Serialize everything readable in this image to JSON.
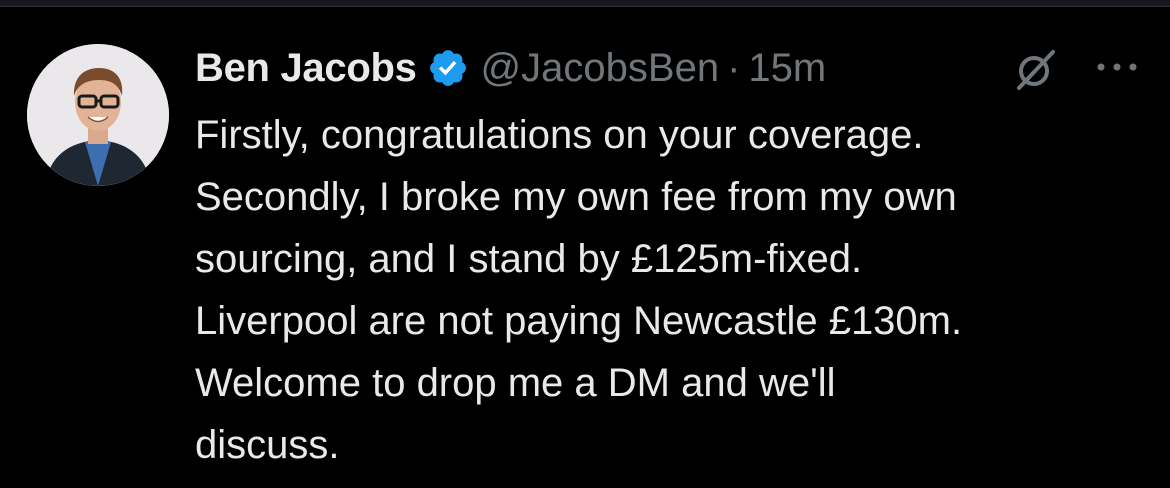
{
  "colors": {
    "background": "#000000",
    "text_primary": "#e7e9ea",
    "text_secondary": "#71767b",
    "verified_blue": "#1d9bf0"
  },
  "tweet": {
    "author": {
      "display_name": "Ben Jacobs",
      "handle": "@JacobsBen",
      "verified": true
    },
    "separator": "·",
    "timestamp": "15m",
    "icons": {
      "avatar": "avatar-photo",
      "verified": "verified-badge-icon",
      "edited": "grok-slash-icon",
      "more": "more-options-icon"
    },
    "text_lines": [
      "Firstly, congratulations on your coverage.",
      "Secondly, I broke my own fee from my own",
      "sourcing, and I stand by £125m-fixed.",
      "Liverpool are not paying Newcastle £130m.",
      "Welcome to drop me a DM and we'll",
      "discuss."
    ]
  }
}
